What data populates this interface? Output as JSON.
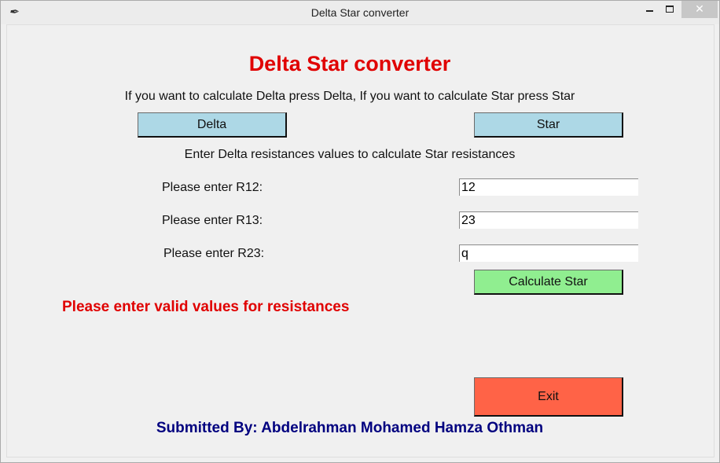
{
  "window": {
    "title": "Delta Star converter",
    "app_icon": "feather-icon",
    "controls": {
      "minimize": "minimize-icon",
      "maximize": "maximize-icon",
      "close": "✕"
    }
  },
  "main": {
    "heading": "Delta Star converter",
    "instructions": "If you want to calculate Delta press Delta, If you want to calculate Star press Star",
    "buttons": {
      "delta": "Delta",
      "star": "Star",
      "calculate": "Calculate Star",
      "exit": "Exit"
    },
    "subtitle": "Enter Delta resistances values to calculate Star resistances",
    "fields": [
      {
        "label": "Please enter R12:",
        "value": "12"
      },
      {
        "label": "Please enter R13:",
        "value": "23"
      },
      {
        "label": "Please enter R23:",
        "value": "q"
      }
    ],
    "error_message": "Please enter valid values for resistances",
    "credit": "Submitted By: Abdelrahman Mohamed Hamza Othman"
  },
  "colors": {
    "heading": "#e00000",
    "error": "#e00000",
    "credit": "#00007f",
    "delta_star_buttons": "#add8e6",
    "calculate_button": "#90ee90",
    "exit_button": "#ff6347"
  }
}
